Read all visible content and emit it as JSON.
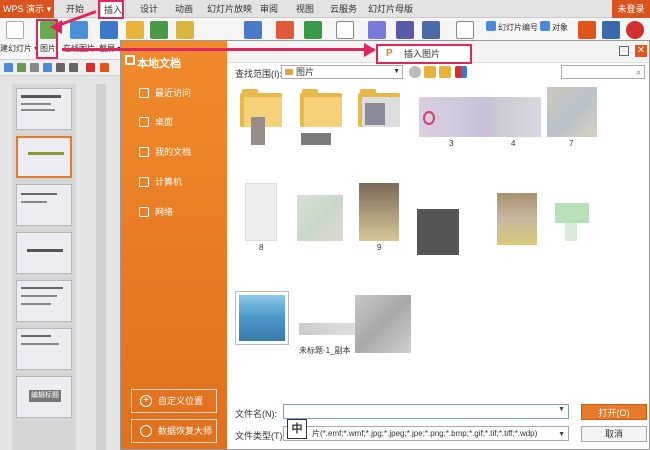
{
  "app": {
    "menu_label": "WPS 演示 ▾",
    "login": "未登录"
  },
  "menu_tabs": [
    {
      "label": "开始"
    },
    {
      "label": "插入"
    },
    {
      "label": "设计"
    },
    {
      "label": "动画"
    },
    {
      "label": "幻灯片放映"
    },
    {
      "label": "审阅"
    },
    {
      "label": "视图"
    },
    {
      "label": "云服务"
    },
    {
      "label": "幻灯片母版"
    }
  ],
  "ribbon": {
    "new_slide": "建幻灯片 ▾",
    "picture": "图片",
    "online_picture": "在线图片",
    "screenshot": "截屏 ▾",
    "slide_number": "幻灯片编号",
    "object": "对象"
  },
  "dialog": {
    "sidebar_title": "本地文档",
    "sidebar_items": [
      {
        "label": "最近访问"
      },
      {
        "label": "桌面"
      },
      {
        "label": "我的文档"
      },
      {
        "label": "计算机"
      },
      {
        "label": "网络"
      }
    ],
    "custom_location": "自定义位置",
    "data_recovery": "数据恢复大师",
    "look_in_label": "查找范围(I):",
    "look_in_value": "图片",
    "insert_picture_tip": "插入图片",
    "file_name_label": "文件名(N):",
    "file_name_value": "",
    "file_type_label": "文件类型(T):",
    "file_type_value": "片(*.emf;*.wmf;*.jpg;*.jpeg;*.jpe;*.png;*.bmp;*.gif;*.tif;*.tiff;*.wdp)",
    "ime_indicator": "中",
    "open_button": "打开(O)",
    "cancel_button": "取消",
    "files": [
      {
        "name": "",
        "kind": "folder"
      },
      {
        "name": "",
        "kind": "folder"
      },
      {
        "name": "",
        "kind": "folder"
      },
      {
        "name": "3",
        "kind": "image"
      },
      {
        "name": "4",
        "kind": "image"
      },
      {
        "name": "7",
        "kind": "image"
      },
      {
        "name": "8",
        "kind": "image"
      },
      {
        "name": "",
        "kind": "image"
      },
      {
        "name": "9",
        "kind": "image"
      },
      {
        "name": "",
        "kind": "image"
      },
      {
        "name": "",
        "kind": "image"
      },
      {
        "name": "",
        "kind": "image"
      },
      {
        "name": "",
        "kind": "image"
      },
      {
        "name": "未标题-1_副本",
        "kind": "image"
      },
      {
        "name": "",
        "kind": "image"
      }
    ]
  },
  "slides": [
    {
      "button_text": ""
    },
    {
      "button_text": ""
    },
    {
      "button_text": ""
    },
    {
      "button_text": ""
    },
    {
      "button_text": ""
    },
    {
      "button_text": "编辑标题"
    },
    {
      "button_text": ""
    }
  ],
  "colors": {
    "accent": "#e8792a",
    "annotation": "#e0245e",
    "folder": "#e7b84c"
  }
}
